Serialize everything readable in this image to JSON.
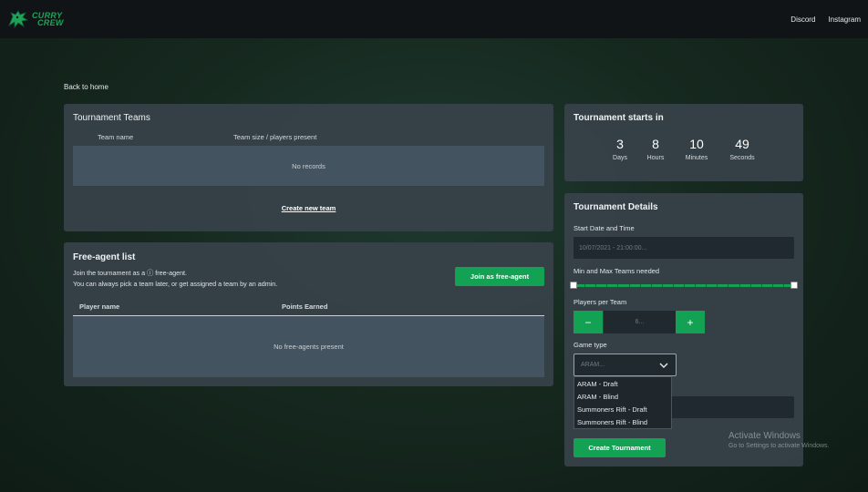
{
  "nav": {
    "logo_line1": "CURRY",
    "logo_line2": "CREW",
    "links": [
      "Discord",
      "Instagram"
    ]
  },
  "back_link": "Back to home",
  "teams_panel": {
    "title": "Tournament Teams",
    "columns": [
      "Team name",
      "Team size / players present"
    ],
    "empty_text": "No records",
    "create_link": "Create new team"
  },
  "free_agent_panel": {
    "title": "Free-agent list",
    "description_line1": "Join the tournament as a ⓘ free-agent.",
    "description_line2": "You can always pick a team later, or get assigned a team by an admin.",
    "join_button": "Join as free-agent",
    "columns": [
      "Player name",
      "Points Earned"
    ],
    "empty_text": "No free-agents present"
  },
  "countdown": {
    "title": "Tournament starts in",
    "items": [
      {
        "value": "3",
        "label": "Days"
      },
      {
        "value": "8",
        "label": "Hours"
      },
      {
        "value": "10",
        "label": "Minutes"
      },
      {
        "value": "49",
        "label": "Seconds"
      }
    ]
  },
  "details": {
    "title": "Tournament Details",
    "start_label": "Start Date and Time",
    "start_placeholder": "10/07/2021 - 21:00:00...",
    "teams_label": "Min and Max Teams needed",
    "teams_range_min_fraction": 0,
    "teams_range_max_fraction": 1,
    "players_label": "Players per Team",
    "players_placeholder": "6...",
    "minus": "−",
    "plus": "+",
    "game_type_label": "Game type",
    "game_type_placeholder": "ARAM...",
    "game_type_options": [
      "ARAM - Draft",
      "ARAM - Blind",
      "Summoners Rift - Draft",
      "Summoners Rift - Blind"
    ],
    "create_button": "Create Tournament"
  },
  "watermark": {
    "line1": "Activate Windows",
    "line2": "Go to Settings to activate Windows."
  },
  "colors": {
    "accent": "#13a154",
    "panel": "#37424a",
    "navbar": "#111416"
  }
}
